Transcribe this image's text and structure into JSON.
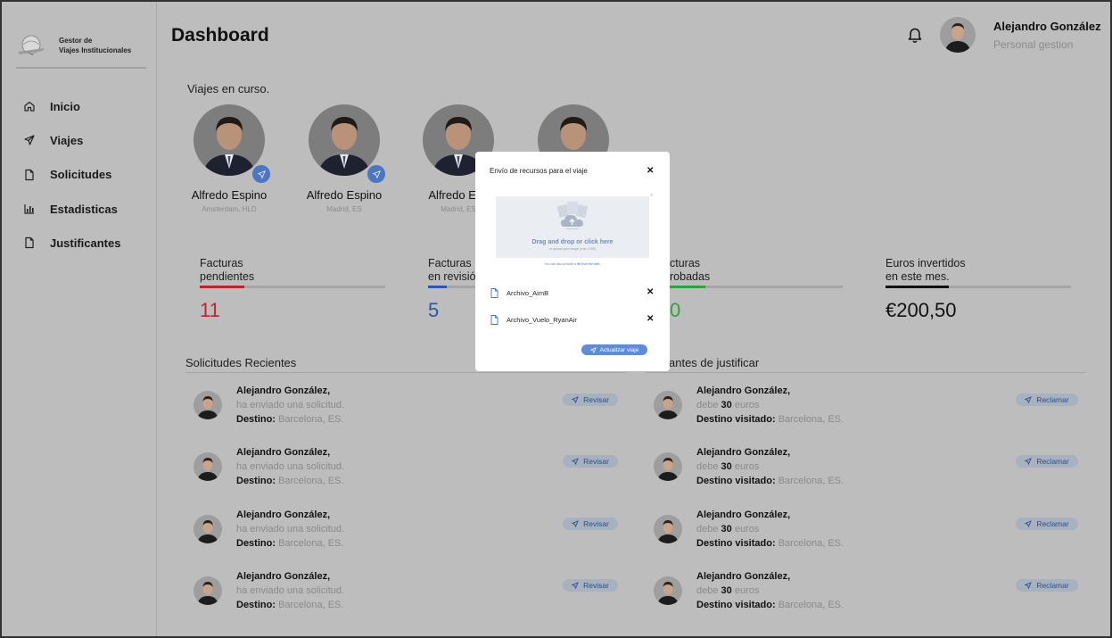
{
  "app": {
    "logo_line1": "Gestor de",
    "logo_line2": "Viajes Institucionales"
  },
  "sidebar": {
    "items": [
      {
        "label": "Inicio",
        "icon": "home-icon"
      },
      {
        "label": "Viajes",
        "icon": "plane-icon"
      },
      {
        "label": "Solicitudes",
        "icon": "document-icon"
      },
      {
        "label": "Estadisticas",
        "icon": "bar-chart-icon"
      },
      {
        "label": "Justificantes",
        "icon": "document-icon"
      }
    ]
  },
  "header": {
    "title": "Dashboard",
    "user_name": "Alejandro González",
    "user_role": "Personal gestion"
  },
  "trips": {
    "label": "Viajes en curso.",
    "items": [
      {
        "name": "Alfredo Espino",
        "location": "Amsterdam, HLD"
      },
      {
        "name": "Alfredo Espino",
        "location": "Madrid, ES"
      },
      {
        "name": "Alfredo Esp",
        "location": "Madrid, ES"
      }
    ]
  },
  "stats": [
    {
      "label_1": "Facturas",
      "label_2": "pendientes",
      "value": "11",
      "color": "#c0222a",
      "progress": 0.24
    },
    {
      "label_1": "Facturas",
      "label_2": "en revisió",
      "value": "5",
      "color": "#2d58a8",
      "progress": 0.1
    },
    {
      "label_1": "cturas",
      "label_2": "robadas",
      "value": "0",
      "color": "#2fa33a",
      "progress": 0.26
    },
    {
      "label_1": "Euros invertidos",
      "label_2": "en este mes.",
      "value": "€200,50",
      "color": "#111111",
      "progress": 0.34
    }
  ],
  "requests": {
    "header": "Solicitudes Recientes",
    "action_label": "Revisar",
    "rows": [
      {
        "name": "Alejandro González,",
        "text": "ha enviado una solicitud.",
        "dest_label": "Destino:",
        "dest_value": "Barcelona, ES."
      },
      {
        "name": "Alejandro González,",
        "text": "ha enviado una solicitud.",
        "dest_label": "Destino:",
        "dest_value": "Barcelona, ES."
      },
      {
        "name": "Alejandro González,",
        "text": "ha enviado una solicitud.",
        "dest_label": "Destino:",
        "dest_value": "Barcelona, ES."
      },
      {
        "name": "Alejandro González,",
        "text": "ha enviado una solicitud.",
        "dest_label": "Destino:",
        "dest_value": "Barcelona, ES."
      }
    ]
  },
  "justifications": {
    "header": "antes de justificar",
    "action_label": "Reclamar",
    "rows": [
      {
        "name": "Alejandro González,",
        "debe": "debe",
        "amount": "30",
        "unit": "euros",
        "dest_label": "Destino visitado:",
        "dest_value": "Barcelona, ES."
      },
      {
        "name": "Alejandro González,",
        "debe": "debe",
        "amount": "30",
        "unit": "euros",
        "dest_label": "Destino visitado:",
        "dest_value": "Barcelona, ES."
      },
      {
        "name": "Alejandro González,",
        "debe": "debe",
        "amount": "30",
        "unit": "euros",
        "dest_label": "Destino visitado:",
        "dest_value": "Barcelona, ES."
      },
      {
        "name": "Alejandro González,",
        "debe": "debe",
        "amount": "30",
        "unit": "euros",
        "dest_label": "Destino visitado:",
        "dest_value": "Barcelona, ES."
      }
    ]
  },
  "modal": {
    "title": "Envío de recursos para el viaje",
    "dropzone_main": "Drag and drop or click here",
    "dropzone_sub": "or upload your image (max 2 MB)",
    "link_prefix": "You can also provide a",
    "link_text": "file from the web.",
    "files": [
      "Archivo_AimB",
      "Archivo_Vuelo_RyanAir"
    ],
    "submit_label": "Actualizar viaje"
  }
}
